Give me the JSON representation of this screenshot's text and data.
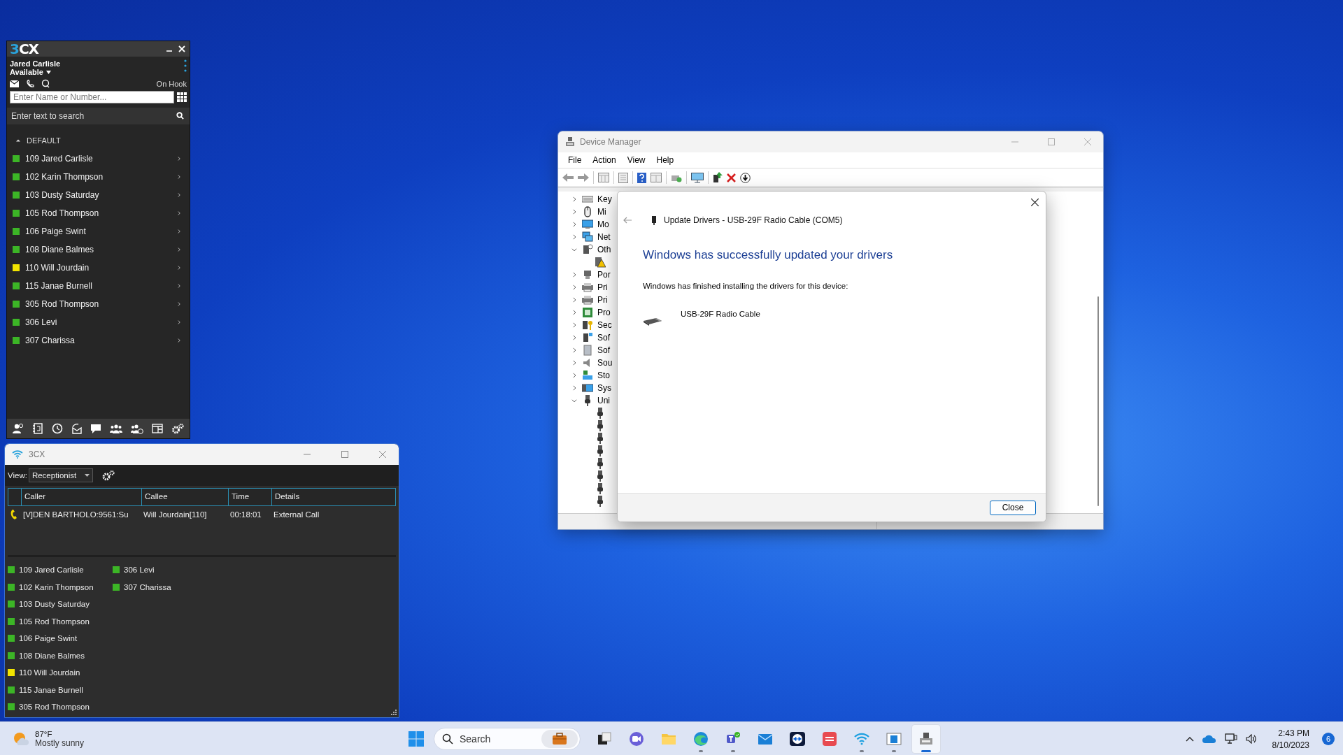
{
  "panel": {
    "logo": "3CX",
    "user": "Jared Carlisle",
    "status": "Available",
    "hook": "On Hook",
    "dial_placeholder": "Enter Name or Number...",
    "search_placeholder": "Enter text to search",
    "group": {
      "label": "DEFAULT",
      "expanded": true
    },
    "contacts": [
      {
        "name": "109 Jared Carlisle",
        "color": "#3cb526"
      },
      {
        "name": "102 Karin Thompson",
        "color": "#3cb526"
      },
      {
        "name": "103 Dusty Saturday",
        "color": "#3cb526"
      },
      {
        "name": "105 Rod Thompson",
        "color": "#3cb526"
      },
      {
        "name": "106 Paige Swint",
        "color": "#3cb526"
      },
      {
        "name": "108 Diane Balmes",
        "color": "#3cb526"
      },
      {
        "name": "110 Will Jourdain",
        "color": "#f2e400"
      },
      {
        "name": "115 Janae Burnell",
        "color": "#3cb526"
      },
      {
        "name": "305 Rod Thompson",
        "color": "#3cb526"
      },
      {
        "name": "306 Levi",
        "color": "#3cb526"
      },
      {
        "name": "307 Charissa",
        "color": "#3cb526"
      }
    ]
  },
  "console": {
    "title": "3CX",
    "view_label": "View:",
    "view": "Receptionist",
    "columns": [
      "Caller",
      "Callee",
      "Time",
      "Details"
    ],
    "calls": [
      {
        "caller": "[V]DEN BARTHOLO:9561:Su",
        "callee": "Will Jourdain[110]",
        "time": "00:18:01",
        "details": "External Call"
      }
    ],
    "extensions": [
      {
        "name": "109 Jared Carlisle",
        "color": "#3cb526"
      },
      {
        "name": "102 Karin Thompson",
        "color": "#3cb526"
      },
      {
        "name": "103 Dusty Saturday",
        "color": "#3cb526"
      },
      {
        "name": "105 Rod Thompson",
        "color": "#3cb526"
      },
      {
        "name": "106 Paige Swint",
        "color": "#3cb526"
      },
      {
        "name": "108 Diane Balmes",
        "color": "#3cb526"
      },
      {
        "name": "110 Will Jourdain",
        "color": "#f2e400"
      },
      {
        "name": "115 Janae Burnell",
        "color": "#3cb526"
      },
      {
        "name": "305 Rod Thompson",
        "color": "#3cb526"
      },
      {
        "name": "306 Levi",
        "color": "#3cb526"
      },
      {
        "name": "307 Charissa",
        "color": "#3cb526"
      }
    ]
  },
  "device_manager": {
    "title": "Device Manager",
    "menu": [
      "File",
      "Action",
      "View",
      "Help"
    ],
    "tree": [
      {
        "kind": "keyboard",
        "label": "Key",
        "expanded": false
      },
      {
        "kind": "mouse",
        "label": "Mi",
        "expanded": false
      },
      {
        "kind": "monitor",
        "label": "Mo",
        "expanded": false
      },
      {
        "kind": "network",
        "label": "Net",
        "expanded": false
      },
      {
        "kind": "other",
        "label": "Oth",
        "expanded": true,
        "children": [
          {
            "kind": "warning"
          }
        ]
      },
      {
        "kind": "port",
        "label": "Por",
        "expanded": false
      },
      {
        "kind": "printer",
        "label": "Pri",
        "expanded": false
      },
      {
        "kind": "printer",
        "label": "Pri",
        "expanded": false
      },
      {
        "kind": "processor",
        "label": "Pro",
        "expanded": false
      },
      {
        "kind": "security",
        "label": "Sec",
        "expanded": false
      },
      {
        "kind": "software",
        "label": "Sof",
        "expanded": false
      },
      {
        "kind": "box",
        "label": "Sof",
        "expanded": false
      },
      {
        "kind": "sound",
        "label": "Sou",
        "expanded": false
      },
      {
        "kind": "storage",
        "label": "Sto",
        "expanded": false
      },
      {
        "kind": "system",
        "label": "Sys",
        "expanded": false
      },
      {
        "kind": "usb",
        "label": "Uni",
        "expanded": true,
        "children": [
          {
            "kind": "usb"
          },
          {
            "kind": "usb"
          },
          {
            "kind": "usb"
          },
          {
            "kind": "usb"
          },
          {
            "kind": "usb"
          },
          {
            "kind": "usb"
          },
          {
            "kind": "usb"
          },
          {
            "kind": "usb"
          }
        ]
      }
    ],
    "dialog": {
      "heading": "Update Drivers - USB-29F Radio Cable (COM5)",
      "title": "Windows has successfully updated your drivers",
      "message": "Windows has finished installing the drivers for this device:",
      "device": "USB-29F Radio Cable",
      "button": "Close"
    }
  },
  "taskbar": {
    "weather": {
      "temperature": "87°F",
      "condition": "Mostly sunny"
    },
    "search_placeholder": "Search",
    "apps": [
      {
        "kind": "task-view",
        "running": false,
        "active": false
      },
      {
        "kind": "video-chat",
        "running": false,
        "active": false
      },
      {
        "kind": "folder",
        "running": false,
        "active": false
      },
      {
        "kind": "browser",
        "running": true,
        "active": false
      },
      {
        "kind": "teams",
        "running": true,
        "active": false
      },
      {
        "kind": "mail",
        "running": false,
        "active": false
      },
      {
        "kind": "remote",
        "running": false,
        "active": false
      },
      {
        "kind": "tool",
        "running": false,
        "active": false
      },
      {
        "kind": "wifi",
        "running": true,
        "active": false
      },
      {
        "kind": "window",
        "running": true,
        "active": false
      },
      {
        "kind": "device-manager",
        "running": true,
        "active": true
      }
    ],
    "time": "2:43 PM",
    "date": "8/10/2023",
    "notifications": "6"
  }
}
